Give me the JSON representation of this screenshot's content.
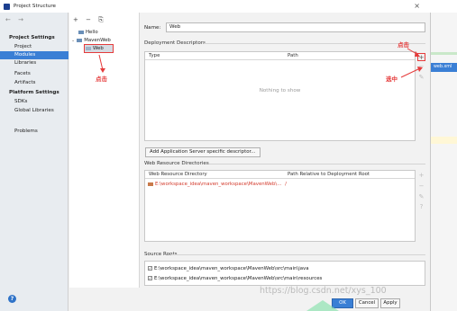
{
  "window": {
    "title": "Project Structure",
    "close_glyph": "×"
  },
  "left_nav": {
    "back_forward": "← →",
    "project_settings": "Project Settings",
    "items": [
      "Project",
      "Modules",
      "Libraries",
      "Facets",
      "Artifacts"
    ],
    "platform_settings": "Platform Settings",
    "platform_items": [
      "SDKs",
      "Global Libraries"
    ],
    "problems": "Problems",
    "help": "?"
  },
  "tree": {
    "toolbar": "+ − ⎘",
    "items": [
      "Hello",
      "MavenWeb",
      "Web"
    ]
  },
  "main": {
    "name_label": "Name:",
    "name_value": "Web",
    "deployment_title": "Deployment Descriptors",
    "dd_columns": [
      "Type",
      "Path"
    ],
    "dd_empty": "Nothing to show",
    "add_app_server_button": "Add Application Server specific descriptor...",
    "web_resource_title": "Web Resource Directories",
    "wr_columns": [
      "Web Resource Directory",
      "Path Relative to Deployment Root"
    ],
    "wr_row": {
      "dir": "E:\\workspace_idea\\maven_workspace\\MavenWeb\\...",
      "path": "/"
    },
    "source_roots_title": "Source Roots",
    "source_roots": [
      "E:\\workspace_idea\\maven_workspace\\MavenWeb\\src\\main\\java",
      "E:\\workspace_idea\\maven_workspace\\MavenWeb\\src\\main\\resources"
    ],
    "side_buttons": {
      "plus": "+",
      "minus": "−",
      "edit": "✎",
      "help": "?"
    }
  },
  "footer": {
    "ok": "OK",
    "cancel": "Cancel",
    "apply": "Apply"
  },
  "annotations": {
    "click_tree": "点击",
    "click_plus": "点击",
    "select": "选中"
  },
  "popup": {
    "item": "web.xml"
  },
  "watermark": "https://blog.csdn.net/xys_100"
}
